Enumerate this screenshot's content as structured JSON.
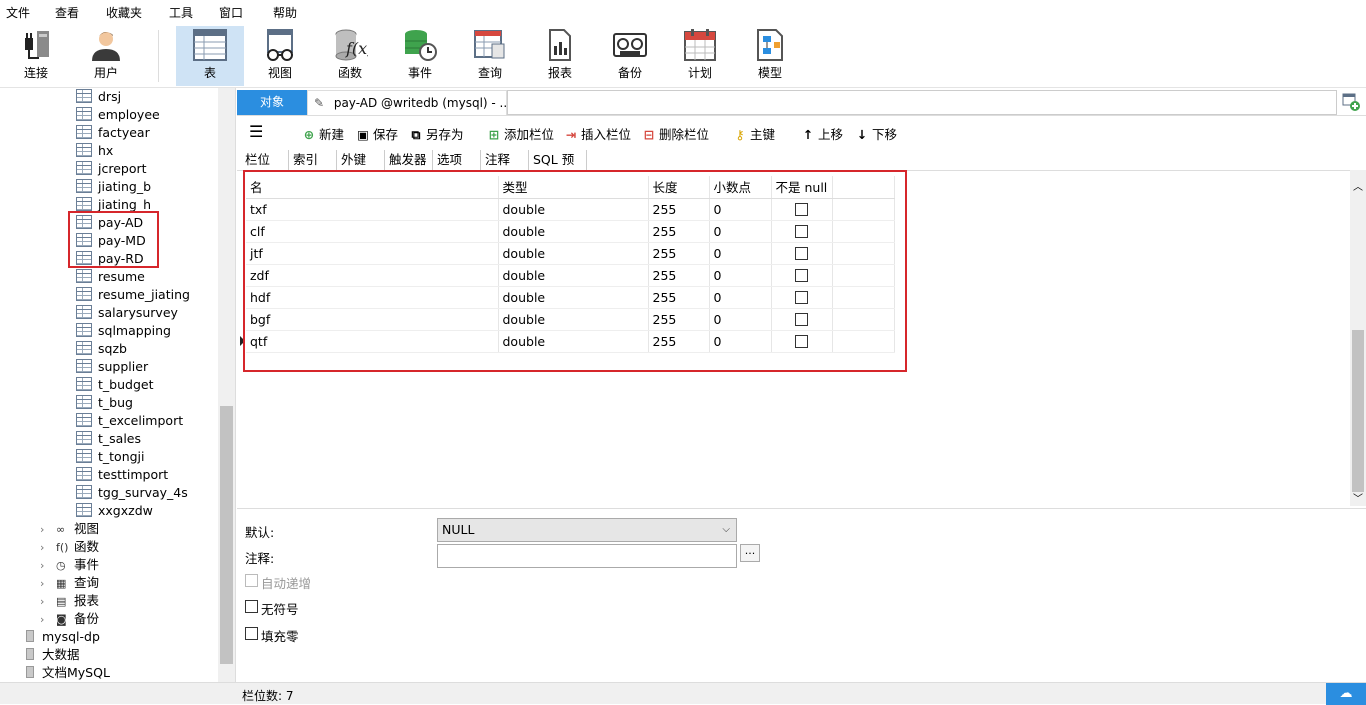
{
  "menu": [
    "文件",
    "查看",
    "收藏夹",
    "工具",
    "窗口",
    "帮助"
  ],
  "toolbar": [
    {
      "label": "连接",
      "icon": "plug-icon"
    },
    {
      "label": "用户",
      "icon": "user-icon"
    },
    {
      "label": "表",
      "icon": "table-icon",
      "active": true
    },
    {
      "label": "视图",
      "icon": "view-glasses-icon"
    },
    {
      "label": "函数",
      "icon": "function-icon"
    },
    {
      "label": "事件",
      "icon": "event-clock-icon"
    },
    {
      "label": "查询",
      "icon": "query-icon"
    },
    {
      "label": "报表",
      "icon": "report-icon"
    },
    {
      "label": "备份",
      "icon": "backup-tape-icon"
    },
    {
      "label": "计划",
      "icon": "calendar-icon"
    },
    {
      "label": "模型",
      "icon": "model-icon"
    }
  ],
  "sidebar": {
    "tables": [
      "drsj",
      "employee",
      "factyear",
      "hx",
      "jcreport",
      "jiating_b",
      "jiating_h",
      "pay-AD",
      "pay-MD",
      "pay-RD",
      "resume",
      "resume_jiating",
      "salarysurvey",
      "sqlmapping",
      "sqzb",
      "supplier",
      "t_budget",
      "t_bug",
      "t_excelimport",
      "t_sales",
      "t_tongji",
      "testtimport",
      "tgg_survay_4s",
      "xxgxzdw"
    ],
    "groups": [
      {
        "label": "视图",
        "icon": "glasses-icon"
      },
      {
        "label": "函数",
        "icon": "function-icon"
      },
      {
        "label": "事件",
        "icon": "event-icon"
      },
      {
        "label": "查询",
        "icon": "query-icon"
      },
      {
        "label": "报表",
        "icon": "report-icon"
      },
      {
        "label": "备份",
        "icon": "backup-icon"
      }
    ],
    "databases": [
      "mysql-dp",
      "大数据",
      "文档MySQL"
    ]
  },
  "tabs": {
    "objects": "对象",
    "document": "pay-AD @writedb (mysql) - ..."
  },
  "editor_toolbar": [
    {
      "label": "",
      "icon": "hamburger-menu-icon"
    },
    {
      "label": "新建",
      "icon": "new-plus-icon"
    },
    {
      "label": "保存",
      "icon": "save-disk-icon"
    },
    {
      "label": "另存为",
      "icon": "save-as-icon"
    },
    {
      "label": "添加栏位",
      "icon": "add-field-icon"
    },
    {
      "label": "插入栏位",
      "icon": "insert-field-icon"
    },
    {
      "label": "删除栏位",
      "icon": "delete-field-icon"
    },
    {
      "label": "主键",
      "icon": "key-icon"
    },
    {
      "label": "上移",
      "icon": "arrow-up-icon"
    },
    {
      "label": "下移",
      "icon": "arrow-down-icon"
    }
  ],
  "subtabs": [
    "栏位",
    "索引",
    "外键",
    "触发器",
    "选项",
    "注释",
    "SQL 预览"
  ],
  "grid": {
    "headers": [
      "名",
      "类型",
      "长度",
      "小数点",
      "不是 null"
    ],
    "rows": [
      {
        "name": "txf",
        "type": "double",
        "length": "255",
        "decimals": "0"
      },
      {
        "name": "clf",
        "type": "double",
        "length": "255",
        "decimals": "0"
      },
      {
        "name": "jtf",
        "type": "double",
        "length": "255",
        "decimals": "0"
      },
      {
        "name": "zdf",
        "type": "double",
        "length": "255",
        "decimals": "0"
      },
      {
        "name": "hdf",
        "type": "double",
        "length": "255",
        "decimals": "0"
      },
      {
        "name": "bgf",
        "type": "double",
        "length": "255",
        "decimals": "0"
      },
      {
        "name": "qtf",
        "type": "double",
        "length": "255",
        "decimals": "0"
      }
    ]
  },
  "properties": {
    "default_label": "默认:",
    "default_value": "NULL",
    "comment_label": "注释:",
    "comment_button": "...",
    "auto_increment": "自动递增",
    "unsigned": "无符号",
    "zerofill": "填充零"
  },
  "status": {
    "field_count": "栏位数: 7"
  },
  "colors": {
    "accent": "#2b8ee0",
    "highlight_box": "#d6262b"
  }
}
